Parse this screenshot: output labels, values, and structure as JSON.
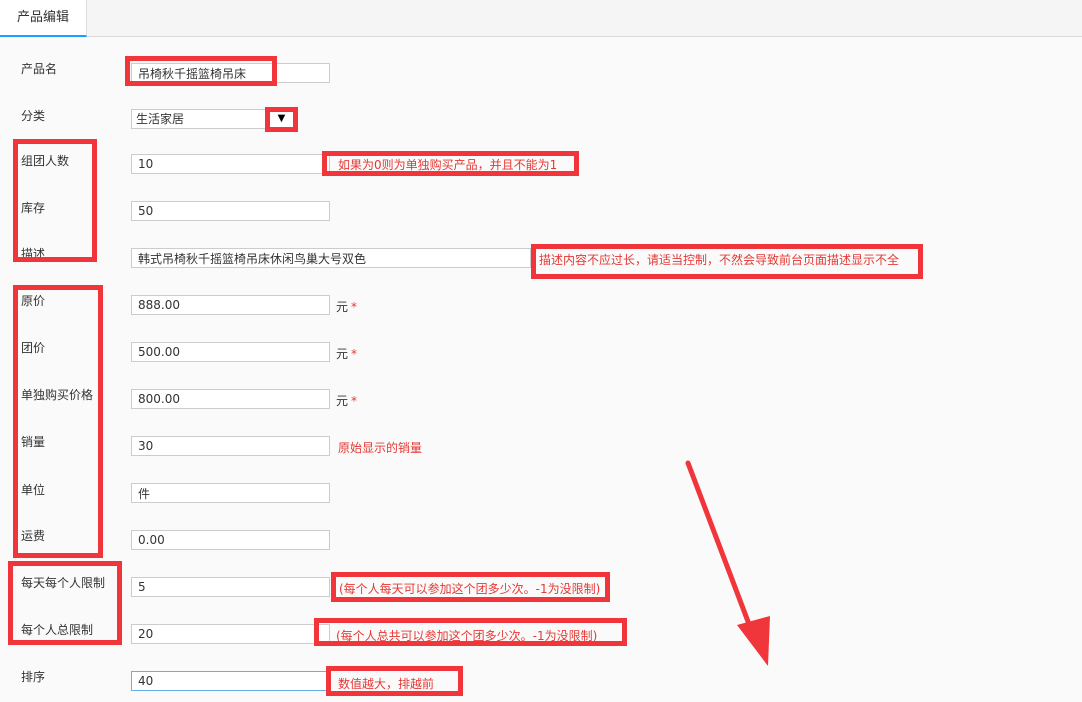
{
  "tab": {
    "label": "产品编辑"
  },
  "form": {
    "product_name": {
      "label": "产品名",
      "value": "吊椅秋千摇篮椅吊床"
    },
    "category": {
      "label": "分类",
      "value": "生活家居",
      "dropdown_icon": "▼"
    },
    "group_size": {
      "label": "组团人数",
      "value": "10",
      "hint": "如果为0则为单独购买产品，并且不能为1"
    },
    "stock": {
      "label": "库存",
      "value": "50"
    },
    "description": {
      "label": "描述",
      "value": "韩式吊椅秋千摇篮椅吊床休闲鸟巢大号双色",
      "hint": "描述内容不应过长，请适当控制，不然会导致前台页面描述显示不全"
    },
    "original_price": {
      "label": "原价",
      "value": "888.00",
      "unit": "元",
      "required": "*"
    },
    "group_price": {
      "label": "团价",
      "value": "500.00",
      "unit": "元",
      "required": "*"
    },
    "single_price": {
      "label": "单独购买价格",
      "value": "800.00",
      "unit": "元",
      "required": "*"
    },
    "sales": {
      "label": "销量",
      "value": "30",
      "hint": "原始显示的销量"
    },
    "unit_field": {
      "label": "单位",
      "value": "件"
    },
    "shipping": {
      "label": "运费",
      "value": "0.00"
    },
    "daily_limit": {
      "label": "每天每个人限制",
      "value": "5",
      "hint": "(每个人每天可以参加这个团多少次。-1为没限制)"
    },
    "total_limit": {
      "label": "每个人总限制",
      "value": "20",
      "hint": "(每个人总共可以参加这个团多少次。-1为没限制)"
    },
    "sort": {
      "label": "排序",
      "value": "40",
      "hint": "数值越大，排越前"
    }
  },
  "colors": {
    "accent": "#1e9fff",
    "annotation": "#f0353b",
    "hint": "#e53935"
  }
}
